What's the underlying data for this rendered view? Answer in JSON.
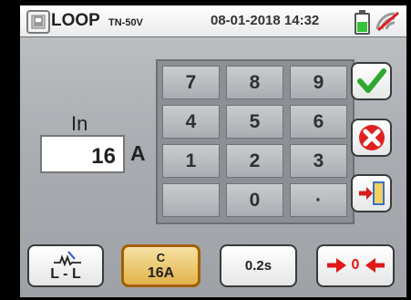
{
  "header": {
    "title": "LOOP",
    "subtitle": "TN-50V",
    "datetime": "08-01-2018 14:32",
    "icons": [
      "home-icon",
      "battery-icon",
      "no-signal-icon"
    ]
  },
  "parameter": {
    "label": "In",
    "value": "16",
    "unit": "A"
  },
  "keypad": {
    "keys": [
      "7",
      "8",
      "9",
      "4",
      "5",
      "6",
      "1",
      "2",
      "3",
      "",
      "0",
      "·"
    ]
  },
  "side_actions": [
    {
      "name": "confirm",
      "icon": "check-icon"
    },
    {
      "name": "cancel",
      "icon": "x-icon"
    },
    {
      "name": "exit",
      "icon": "exit-door-icon"
    }
  ],
  "toolbar": {
    "mode_label": "L - L",
    "curve_label": "C",
    "curve_value": "16A",
    "time_label": "0.2s",
    "zero_label": "0"
  },
  "colors": {
    "background": "#a9adb1",
    "selected_button": "#e2b349",
    "check_green": "#2fa82f",
    "cancel_red": "#e02020",
    "zero_red": "#e11818"
  }
}
